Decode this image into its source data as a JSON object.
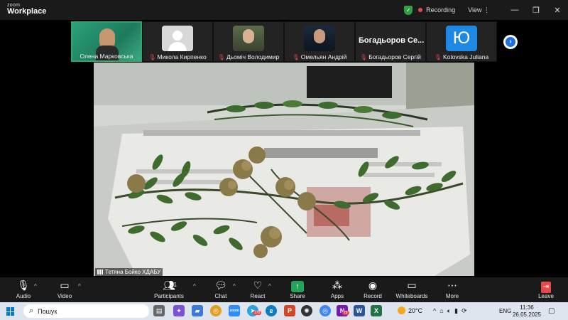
{
  "app": {
    "brand_small": "zoom",
    "brand_large": "Workplace"
  },
  "topbar": {
    "recording_label": "Recording",
    "view_label": "View",
    "window_controls": [
      "minimize-icon",
      "restore-icon",
      "close-icon"
    ]
  },
  "participants": [
    {
      "name": "Олена Марковська",
      "muted": false,
      "video": "photo",
      "active": true
    },
    {
      "name": "Микола Кирпенко",
      "muted": true,
      "video": "none"
    },
    {
      "name": "Дьоміч Володимир",
      "muted": true,
      "video": "photo"
    },
    {
      "name": "Омельян Андрій",
      "muted": true,
      "video": "photo"
    },
    {
      "name": "Богадьоров Сергій",
      "display_name": "Богадьоров Се...",
      "muted": true,
      "video": "name"
    },
    {
      "name": "Kotovska Juliana",
      "muted": true,
      "video": "letter",
      "initial": "Ю"
    }
  ],
  "main_video": {
    "speaker_name": "Тетяна Бойко ХДАБУ"
  },
  "toolbar": {
    "audio": "Audio",
    "video": "Video",
    "participants": "Participants",
    "participants_count": "31",
    "chat": "Chat",
    "react": "React",
    "share": "Share",
    "apps": "Apps",
    "record": "Record",
    "whiteboards": "Whiteboards",
    "more": "More",
    "leave": "Leave"
  },
  "taskbar": {
    "search_placeholder": "Пошук",
    "weather": "20°C",
    "language": "ENG",
    "time": "11:36",
    "date": "26.05.2025",
    "badges": {
      "telegram": "170",
      "onenote": "79"
    }
  },
  "colors": {
    "recording": "#e5484d",
    "share": "#22a35a",
    "active_tile": "#2ea66b",
    "next": "#1f6fe0"
  }
}
